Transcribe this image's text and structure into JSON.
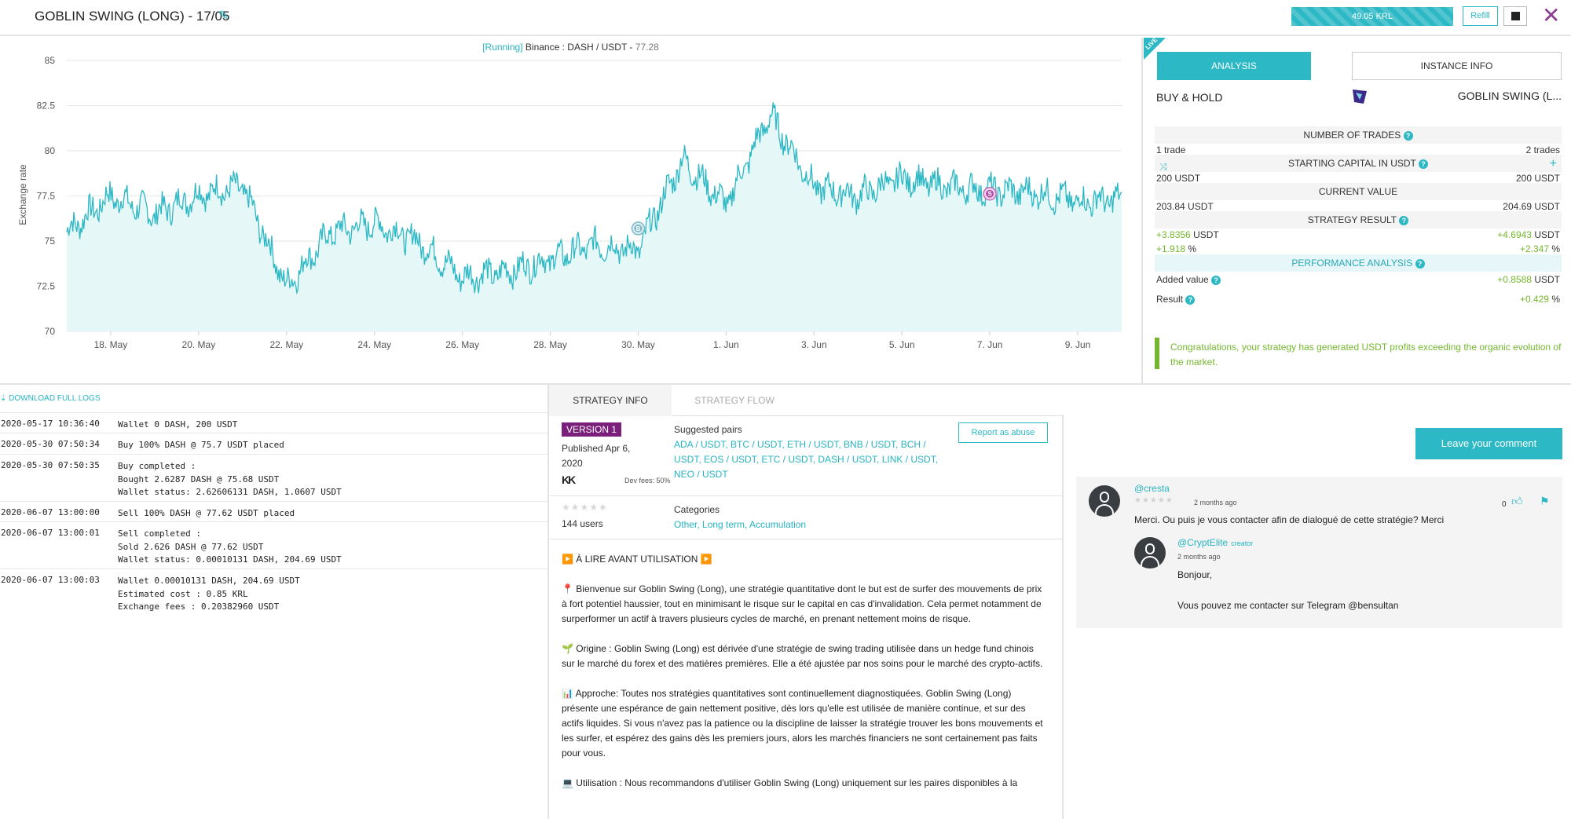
{
  "header": {
    "title": "GOBLIN SWING (LONG) - 17/05",
    "credits": "49.05 KRL",
    "credit_fill_percent": 100,
    "refill_label": "Refill"
  },
  "chart": {
    "status": "[Running]",
    "exchange": "Binance :",
    "pair": "DASH / USDT -",
    "price": "77.28",
    "ylabel": "Exchange rate",
    "yticks": [
      "85",
      "82.5",
      "80",
      "77.5",
      "75",
      "72.5",
      "70"
    ],
    "xticks": [
      "18. May",
      "20. May",
      "22. May",
      "24. May",
      "26. May",
      "28. May",
      "30. May",
      "1. Jun",
      "3. Jun",
      "5. Jun",
      "7. Jun",
      "9. Jun"
    ],
    "buy_marker": "B",
    "sell_marker": "S"
  },
  "chart_data": {
    "type": "area",
    "title": "[Running] Binance : DASH / USDT - 77.28",
    "xlabel": "",
    "ylabel": "Exchange rate",
    "ylim": [
      70,
      85
    ],
    "x": [
      "2020-05-17",
      "2020-05-18",
      "2020-05-19",
      "2020-05-20",
      "2020-05-21",
      "2020-05-22",
      "2020-05-23",
      "2020-05-24",
      "2020-05-25",
      "2020-05-26",
      "2020-05-27",
      "2020-05-28",
      "2020-05-29",
      "2020-05-30",
      "2020-05-31",
      "2020-06-01",
      "2020-06-02",
      "2020-06-03",
      "2020-06-04",
      "2020-06-05",
      "2020-06-06",
      "2020-06-07",
      "2020-06-08",
      "2020-06-09",
      "2020-06-10"
    ],
    "series": [
      {
        "values": [
          75.5,
          77.5,
          76.5,
          77.6,
          78.0,
          72.5,
          75.5,
          76.0,
          75.0,
          73.0,
          73.3,
          74.0,
          74.8,
          74.5,
          79.5,
          77.0,
          82.0,
          78.0,
          77.5,
          78.5,
          78.0,
          77.8,
          77.7,
          77.2,
          77.3
        ]
      }
    ],
    "markers": [
      {
        "label": "B",
        "x": "2020-05-30",
        "y": 75.7
      },
      {
        "label": "S",
        "x": "2020-06-07",
        "y": 77.62
      }
    ],
    "grid": true
  },
  "analysis": {
    "live": "LIVE",
    "tab_analysis": "ANALYSIS",
    "tab_instance": "INSTANCE INFO",
    "left_name": "BUY & HOLD",
    "right_name": "GOBLIN SWING (L...",
    "num_trades_label": "NUMBER OF TRADES",
    "trades_left": "1 trade",
    "trades_right": "2 trades",
    "capital_label": "STARTING CAPITAL IN USDT",
    "capital_left": "200 USDT",
    "capital_right": "200 USDT",
    "current_label": "CURRENT VALUE",
    "current_left": "203.84 USDT",
    "current_right": "204.69 USDT",
    "result_label": "STRATEGY RESULT",
    "result_left_num": "+3.8356",
    "result_left_unit": "USDT",
    "result_right_num": "+4.6943",
    "result_right_unit": "USDT",
    "pct_left_num": "+1.918",
    "pct_left_unit": "%",
    "pct_right_num": "+2.347",
    "pct_right_unit": "%",
    "perf_label": "PERFORMANCE ANALYSIS",
    "added_label": "Added value",
    "added_num": "+0.8588",
    "added_unit": "USDT",
    "res_label": "Result",
    "res_num": "+0.429",
    "res_unit": "%",
    "congrats": "Congratulations, your strategy has generated USDT profits exceeding the organic evolution of the market."
  },
  "logs": {
    "download": "DOWNLOAD FULL LOGS",
    "entries": [
      {
        "ts": "2020-05-17 10:36:40",
        "msg": "Wallet 0 DASH, 200 USDT"
      },
      {
        "ts": "2020-05-30 07:50:34",
        "msg": "Buy 100% DASH @ 75.7 USDT placed"
      },
      {
        "ts": "2020-05-30 07:50:35",
        "msg": "Buy completed :\nBought 2.6287 DASH @ 75.68 USDT\nWallet status: 2.62606131 DASH, 1.0607 USDT"
      },
      {
        "ts": "2020-06-07 13:00:00",
        "msg": "Sell 100% DASH @ 77.62 USDT placed"
      },
      {
        "ts": "2020-06-07 13:00:01",
        "msg": "Sell completed :\nSold 2.626 DASH @ 77.62 USDT\nWallet status: 0.00010131 DASH, 204.69 USDT"
      },
      {
        "ts": "2020-06-07 13:00:03",
        "msg": "Wallet 0.00010131 DASH, 204.69 USDT\nEstimated cost : 0.85 KRL\nExchange fees : 0.20382960 USDT"
      }
    ]
  },
  "strategy": {
    "tab_info": "STRATEGY INFO",
    "tab_flow": "STRATEGY FLOW",
    "version": "VERSION 1",
    "published": "Published Apr 6, 2020",
    "kk": "KK",
    "dev_fees": "Dev fees: 50%",
    "suggested_title": "Suggested pairs",
    "suggested_pairs": "ADA / USDT, BTC / USDT, ETH / USDT, BNB / USDT, BCH / USDT, EOS / USDT, ETC / USDT, DASH / USDT, LINK / USDT, NEO / USDT",
    "report": "Report as abuse",
    "users": "144 users",
    "categories_title": "Categories",
    "categories": "Other, Long term, Accumulation",
    "desc_heading": "▶️ À LIRE AVANT UTILISATION ▶️",
    "desc_p1": "📍 Bienvenue sur Goblin Swing (Long), une stratégie quantitative dont le but est de surfer des mouvements de prix à fort potentiel haussier, tout en minimisant le risque sur le capital en cas d'invalidation. Cela permet notamment de surperformer un actif à travers plusieurs cycles de marché, en prenant nettement moins de risque.",
    "desc_p2": "🌱 Origine : Goblin Swing (Long) est dérivée d'une stratégie de swing trading utilisée dans un hedge fund chinois sur le marché du forex et des matières premières. Elle a été ajustée par nos soins pour le marché des crypto-actifs.",
    "desc_p3": "📊 Approche: Toutes nos stratégies quantitatives sont continuellement diagnostiquées. Goblin Swing (Long) présente une espérance de gain nettement positive, dès lors qu'elle est utilisée de manière continue, et sur des actifs liquides. Si vous n'avez pas la patience ou la discipline de laisser la stratégie trouver les bons mouvements et les surfer, et espérez des gains dès les premiers jours, alors les marchés financiers ne sont certainement pas faits pour vous.",
    "desc_p4": "💻 Utilisation : Nous recommandons d'utiliser Goblin Swing (Long) uniquement sur les paires disponibles à la"
  },
  "comments": {
    "leave": "Leave your comment",
    "c1_user": "@cresta",
    "c1_date": "2 months ago",
    "c1_likes": "0",
    "c1_text": "Merci. Ou puis je vous contacter afin de dialogué de cette stratégie? Merci",
    "c2_user": "@CryptElite",
    "c2_role": "creator",
    "c2_date": "2 months ago",
    "c2_line1": "Bonjour,",
    "c2_line2": "Vous pouvez me contacter sur Telegram @bensultan"
  },
  "colors": {
    "accent": "#2cb8c4",
    "positive": "#74b72e",
    "version_badge": "#7b1f7c",
    "close": "#8a3d8f"
  }
}
